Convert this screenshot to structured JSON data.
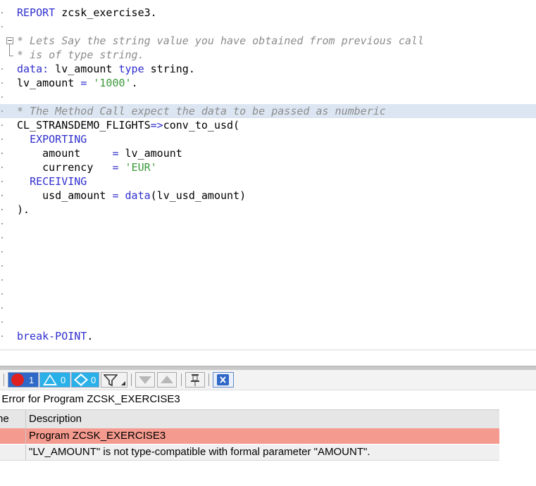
{
  "editor": {
    "lines": [
      {
        "id": "l1",
        "parts": [
          {
            "t": "kw",
            "v": "REPORT"
          },
          {
            "t": "tx",
            "v": " zcsk_exercise3."
          }
        ]
      },
      {
        "id": "l2",
        "parts": []
      },
      {
        "id": "l3",
        "parts": [
          {
            "t": "cm",
            "v": "* Lets Say the string value you have obtained from previous call"
          }
        ]
      },
      {
        "id": "l4",
        "parts": [
          {
            "t": "cm",
            "v": "* is of type string."
          }
        ]
      },
      {
        "id": "l5",
        "parts": [
          {
            "t": "kw",
            "v": "data:"
          },
          {
            "t": "tx",
            "v": " lv_amount "
          },
          {
            "t": "kw",
            "v": "type"
          },
          {
            "t": "tx",
            "v": " string."
          }
        ]
      },
      {
        "id": "l6",
        "parts": [
          {
            "t": "tx",
            "v": "lv_amount "
          },
          {
            "t": "kw",
            "v": "="
          },
          {
            "t": "tx",
            "v": " "
          },
          {
            "t": "st",
            "v": "'1000'"
          },
          {
            "t": "tx",
            "v": "."
          }
        ]
      },
      {
        "id": "l7",
        "parts": []
      },
      {
        "id": "l8",
        "parts": [
          {
            "t": "cm",
            "v": "* The Method Call expect the data to be passed as numberic"
          }
        ]
      },
      {
        "id": "l9",
        "parts": [
          {
            "t": "tx",
            "v": "CL_STRANSDEMO_FLIGHTS"
          },
          {
            "t": "kw",
            "v": "=>"
          },
          {
            "t": "tx",
            "v": "conv_to_usd("
          }
        ]
      },
      {
        "id": "l10",
        "parts": [
          {
            "t": "tx",
            "v": "  "
          },
          {
            "t": "kw",
            "v": "EXPORTING"
          }
        ]
      },
      {
        "id": "l11",
        "parts": [
          {
            "t": "tx",
            "v": "    amount     "
          },
          {
            "t": "kw",
            "v": "="
          },
          {
            "t": "tx",
            "v": " lv_amount"
          }
        ]
      },
      {
        "id": "l12",
        "parts": [
          {
            "t": "tx",
            "v": "    currency   "
          },
          {
            "t": "kw",
            "v": "="
          },
          {
            "t": "tx",
            "v": " "
          },
          {
            "t": "st",
            "v": "'EUR'"
          }
        ]
      },
      {
        "id": "l13",
        "parts": [
          {
            "t": "tx",
            "v": "  "
          },
          {
            "t": "kw",
            "v": "RECEIVING"
          }
        ]
      },
      {
        "id": "l14",
        "parts": [
          {
            "t": "tx",
            "v": "    usd_amount "
          },
          {
            "t": "kw",
            "v": "="
          },
          {
            "t": "tx",
            "v": " "
          },
          {
            "t": "kw",
            "v": "data"
          },
          {
            "t": "tx",
            "v": "(lv_usd_amount)"
          }
        ]
      },
      {
        "id": "l15",
        "parts": [
          {
            "t": "tx",
            "v": ")."
          }
        ]
      },
      {
        "id": "l16",
        "parts": []
      },
      {
        "id": "l17",
        "parts": []
      },
      {
        "id": "l18",
        "parts": []
      },
      {
        "id": "l19",
        "parts": []
      },
      {
        "id": "l20",
        "parts": []
      },
      {
        "id": "l21",
        "parts": []
      },
      {
        "id": "l22",
        "parts": []
      },
      {
        "id": "l23",
        "parts": []
      },
      {
        "id": "l24",
        "parts": [
          {
            "t": "kw",
            "v": "break-POINT"
          },
          {
            "t": "tx",
            "v": "."
          }
        ]
      }
    ]
  },
  "toolbar": {
    "errors_count": "1",
    "warnings_count": "0",
    "info_count": "0"
  },
  "panel": {
    "title": ": Error for Program ZCSK_EXERCISE3",
    "col_name_header": "ne",
    "col_desc_header": "Description",
    "rows": [
      {
        "desc": "Program ZCSK_EXERCISE3"
      },
      {
        "desc": "\"LV_AMOUNT\" is not type-compatible with formal parameter \"AMOUNT\"."
      }
    ]
  },
  "colors": {
    "keyword": "#2f2fcf",
    "comment": "#8c8c8c",
    "string": "#3a9a3a",
    "error_row": "#f59a8e",
    "highlight_line": "#dce6f2",
    "error_icon": "#e02020",
    "warning_icon": "#2ab0e8",
    "info_icon": "#2ab0e8"
  },
  "icons": [
    "error-icon",
    "warning-icon",
    "info-icon",
    "filter-icon",
    "move-down-icon",
    "move-up-icon",
    "pin-icon",
    "close-icon"
  ]
}
